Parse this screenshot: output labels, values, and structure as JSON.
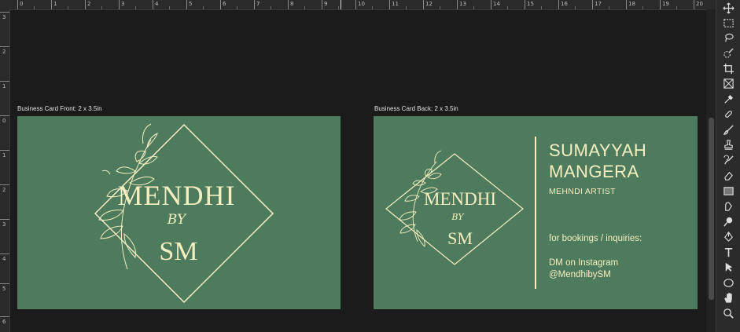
{
  "rulers": {
    "top": [
      "0",
      "1",
      "2",
      "3",
      "4",
      "5",
      "6",
      "7",
      "8",
      "9",
      "10",
      "11",
      "12",
      "13",
      "14",
      "15",
      "16",
      "17",
      "18",
      "19",
      "20"
    ],
    "left": [
      "3",
      "2",
      "1",
      "0",
      "1",
      "2",
      "3",
      "4",
      "5",
      "6"
    ]
  },
  "artboards": {
    "front": {
      "label": "Business Card Front: 2 x 3.5in",
      "brand_line1": "MENDHI",
      "brand_line2": "BY",
      "brand_line3": "SM"
    },
    "back": {
      "label": "Business Card Back: 2 x 3.5in",
      "brand_line1": "MENDHI",
      "brand_line2": "BY",
      "brand_line3": "SM",
      "name_line1": "SUMAYYAH",
      "name_line2": "MANGERA",
      "role": "MEHNDI ARTIST",
      "bookings": "for bookings / inquiries:",
      "contact_line1": "DM on Instagram",
      "contact_line2": "@MendhibySM"
    }
  },
  "colors": {
    "card_green": "#4e7b5d",
    "cream": "#f4efc0",
    "canvas": "#1b1b1b"
  },
  "tools": [
    "move-icon",
    "marquee-icon",
    "lasso-icon",
    "quick-select-icon",
    "crop-icon",
    "frame-icon",
    "eyedropper-icon",
    "healing-icon",
    "brush-icon",
    "stamp-icon",
    "history-brush-icon",
    "eraser-icon",
    "gradient-icon",
    "smudge-icon",
    "dodge-icon",
    "pen-icon",
    "type-icon",
    "path-select-icon",
    "ellipse-icon",
    "hand-icon",
    "zoom-icon"
  ]
}
